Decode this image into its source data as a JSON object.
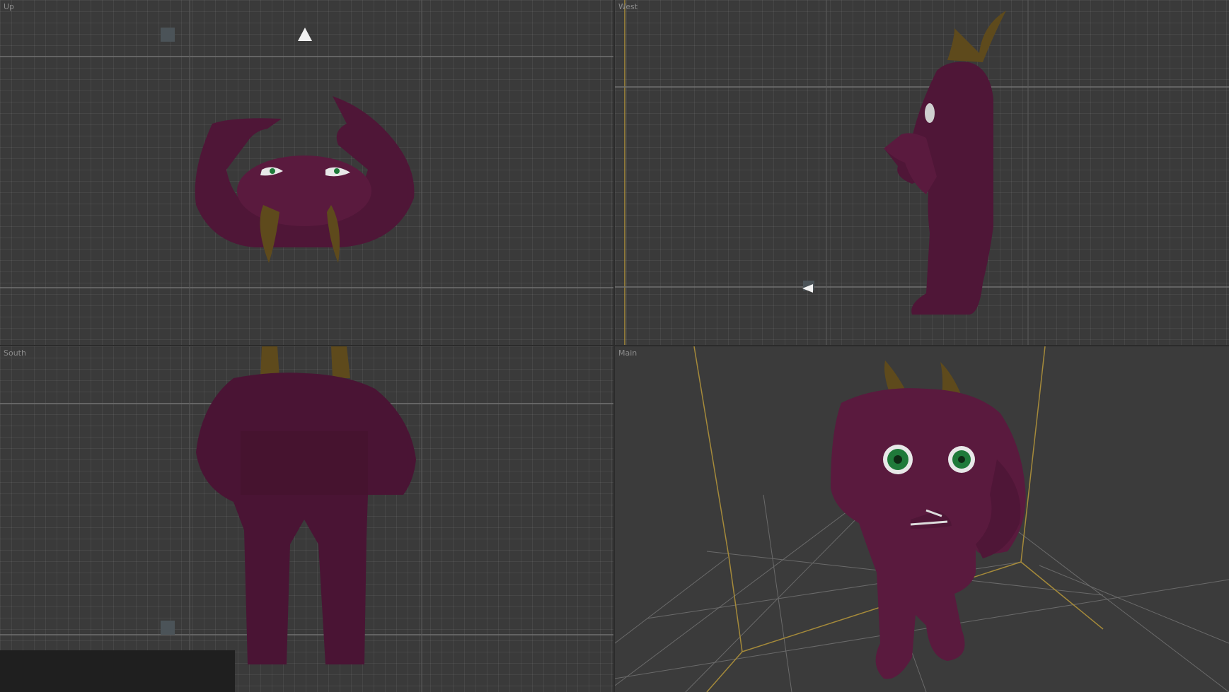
{
  "viewports": {
    "top_left": {
      "label": "Up"
    },
    "top_right": {
      "label": "West"
    },
    "bottom_left": {
      "label": "South"
    },
    "bottom_right": {
      "label": "Main"
    }
  },
  "colors": {
    "viewport_bg": "#3a3a3a",
    "grid_minor": "#464646",
    "grid_major": "#6e6e6e",
    "axis_gold": "#a58a3a",
    "character_body": "#5a1a3e",
    "character_shadow": "#3e1029",
    "horn": "#5e4a1c",
    "eye_iris": "#1f7a3a",
    "eye_white": "#e8e8e8",
    "panel_dark": "#1f1f1f"
  },
  "icons": {
    "camera_marker_top": "triangle-up-icon",
    "camera_marker_west": "triangle-left-icon"
  }
}
